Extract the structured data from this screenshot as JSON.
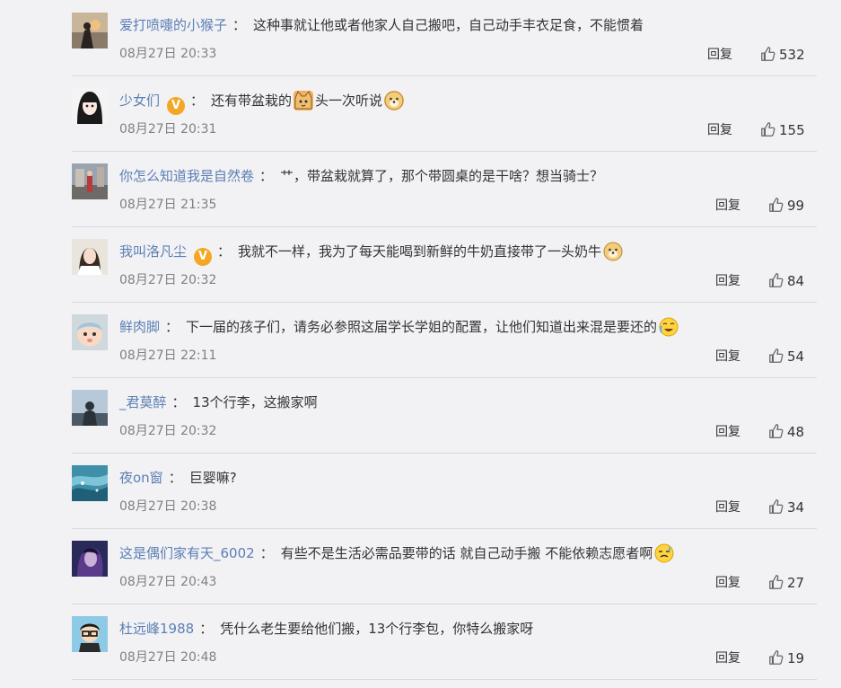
{
  "comments": [
    {
      "user": "爱打喷嚏的小猴子",
      "text": "这种事就让他或者他家人自己搬吧，自己动手丰衣足食，不能惯着",
      "emojis": [],
      "time": "08月27日 20:33",
      "reply": "回复",
      "likes": "532",
      "avatar_icon": "avatar-silhouette-dusk",
      "verified": false
    },
    {
      "user": "少女们",
      "text": "还有带盆栽的",
      "text2": "头一次听说",
      "emojis": [
        "cat-emoji",
        "doge-emoji"
      ],
      "time": "08月27日 20:31",
      "reply": "回复",
      "likes": "155",
      "avatar_icon": "avatar-anime-girl",
      "verified": true
    },
    {
      "user": "你怎么知道我是自然卷",
      "text": "艹，带盆栽就算了，那个带圆桌的是干啥？想当骑士？",
      "emojis": [],
      "time": "08月27日 21:35",
      "reply": "回复",
      "likes": "99",
      "avatar_icon": "avatar-street-photo",
      "verified": false
    },
    {
      "user": "我叫洛凡尘",
      "text": "我就不一样，我为了每天能喝到新鲜的牛奶直接带了一头奶牛",
      "emojis": [
        "doge-emoji"
      ],
      "time": "08月27日 20:32",
      "reply": "回复",
      "likes": "84",
      "avatar_icon": "avatar-portrait",
      "verified": true
    },
    {
      "user": "鲜肉脚",
      "text": "下一届的孩子们，请务必参照这届学长学姐的配置，让他们知道出来混是要还的",
      "emojis": [
        "crying-laugh-emoji"
      ],
      "time": "08月27日 22:11",
      "reply": "回复",
      "likes": "54",
      "avatar_icon": "avatar-baby",
      "verified": false
    },
    {
      "user": "_君莫醉",
      "text": "13个行李，这搬家啊",
      "emojis": [],
      "time": "08月27日 20:32",
      "reply": "回复",
      "likes": "48",
      "avatar_icon": "avatar-person-sky",
      "verified": false
    },
    {
      "user": "夜on窗",
      "text": "巨婴嘛?",
      "emojis": [],
      "time": "08月27日 20:38",
      "reply": "回复",
      "likes": "34",
      "avatar_icon": "avatar-blue-water",
      "verified": false
    },
    {
      "user": "这是偶们家有天_6002",
      "text": "有些不是生活必需品要带的话 就自己动手搬 不能依赖志愿者啊",
      "emojis": [
        "sweat-emoji"
      ],
      "time": "08月27日 20:43",
      "reply": "回复",
      "likes": "27",
      "avatar_icon": "avatar-purple-portrait",
      "verified": false
    },
    {
      "user": "杜远峰1988",
      "text": "凭什么老生要给他们搬，13个行李包，你特么搬家呀",
      "emojis": [],
      "time": "08月27日 20:48",
      "reply": "回复",
      "likes": "19",
      "avatar_icon": "avatar-cartoon-glasses",
      "verified": false
    }
  ],
  "colors": {
    "username": "#5b7fb3",
    "text": "#333333",
    "time": "#808080",
    "badge": "#f5a623",
    "bg": "#f2f2f5"
  }
}
